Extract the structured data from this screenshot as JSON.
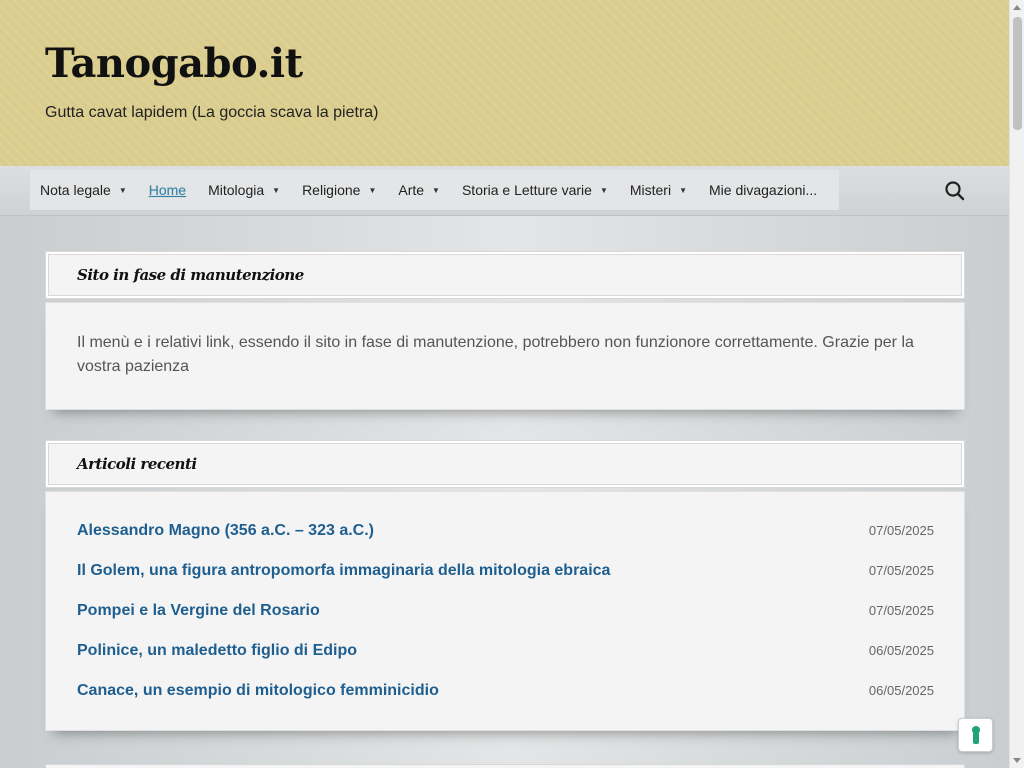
{
  "header": {
    "title": "Tanogabo.it",
    "tagline": "Gutta cavat lapidem (La goccia scava la pietra)"
  },
  "nav": {
    "items": [
      {
        "label": "Nota legale",
        "has_dropdown": true,
        "active": false
      },
      {
        "label": "Home",
        "has_dropdown": false,
        "active": true
      },
      {
        "label": "Mitologia",
        "has_dropdown": true,
        "active": false
      },
      {
        "label": "Religione",
        "has_dropdown": true,
        "active": false
      },
      {
        "label": "Arte",
        "has_dropdown": true,
        "active": false
      },
      {
        "label": "Storia e Letture varie",
        "has_dropdown": true,
        "active": false
      },
      {
        "label": "Misteri",
        "has_dropdown": true,
        "active": false
      },
      {
        "label": "Mie divagazioni...",
        "has_dropdown": false,
        "active": false
      }
    ],
    "search_icon": "search-icon"
  },
  "notice": {
    "title": "Sito in fase di manutenzione",
    "text": "Il menù e i relativi link, essendo il sito in fase di manutenzione, potrebbero non funzionore correttamente. Grazie per la vostra pazienza"
  },
  "recent": {
    "title": "Articoli recenti",
    "items": [
      {
        "title": "Alessandro Magno (356 a.C. – 323 a.C.)",
        "date": "07/05/2025"
      },
      {
        "title": "Il Golem, una figura antropomorfa immaginaria della mitologia ebraica",
        "date": "07/05/2025"
      },
      {
        "title": "Pompei e la Vergine del Rosario",
        "date": "07/05/2025"
      },
      {
        "title": "Polinice, un maledetto figlio di Edipo",
        "date": "06/05/2025"
      },
      {
        "title": "Canace, un esempio di mitologico femminicidio",
        "date": "06/05/2025"
      }
    ]
  },
  "colors": {
    "header_bg": "#d9cc8c",
    "link": "#1f5f8f",
    "active_nav": "#3a7fa6",
    "privacy_icon": "#1fa37a"
  },
  "privacy_badge": {
    "icon": "privacy-lock-icon"
  }
}
